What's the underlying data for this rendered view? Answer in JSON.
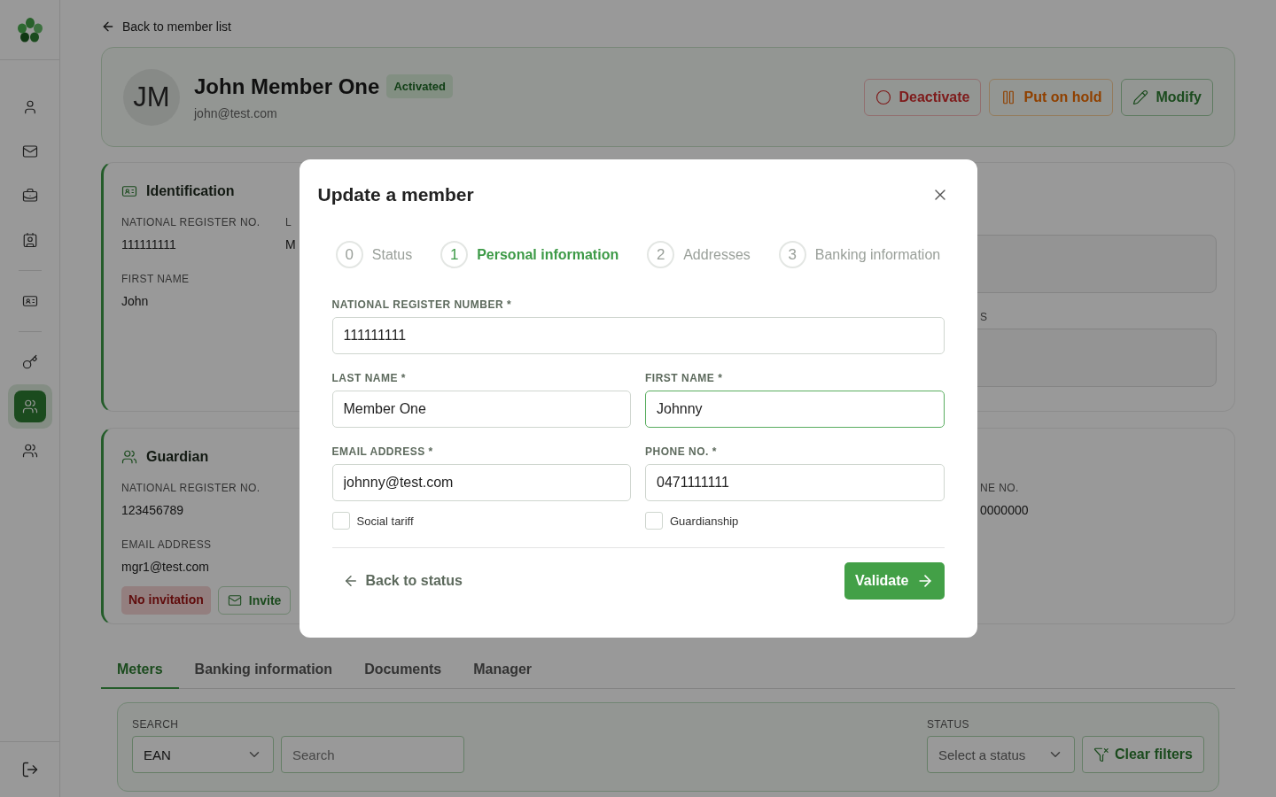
{
  "sidebar": {
    "groups": [
      [
        {
          "selected": false
        },
        {
          "selected": false
        },
        {
          "selected": false
        },
        {
          "selected": false
        }
      ],
      [
        {
          "selected": false
        }
      ],
      [
        {
          "selected": false
        },
        {
          "selected": true
        },
        {
          "selected": false
        }
      ]
    ]
  },
  "back_link": "Back to member list",
  "member": {
    "initials": "JM",
    "name": "John Member One",
    "status": "Activated",
    "email": "john@test.com"
  },
  "actions": [
    {
      "label": "Deactivate",
      "kind": "danger"
    },
    {
      "label": "Put on hold",
      "kind": "warning"
    },
    {
      "label": "Modify",
      "kind": "primary"
    }
  ],
  "identification": {
    "title": "Identification",
    "fields": [
      {
        "label": "NATIONAL REGISTER NO.",
        "value": "111111111"
      },
      {
        "label": "FIRST NAME",
        "value": "John"
      }
    ],
    "column_2": {
      "label": "L",
      "value": "M"
    },
    "column_3": {
      "label": "S"
    }
  },
  "guardian": {
    "title": "Guardian",
    "fields": [
      {
        "label": "NATIONAL REGISTER NO.",
        "value": "123456789"
      },
      {
        "label": "EMAIL ADDRESS",
        "value": "mgr1@test.com"
      }
    ],
    "invitation": "No invitation",
    "invite": "Invite",
    "column_3": {
      "label": "NE NO.",
      "value": "0000000"
    }
  },
  "tabs": [
    {
      "label": "Meters",
      "selected": true
    },
    {
      "label": "Banking information",
      "selected": false
    },
    {
      "label": "Documents",
      "selected": false
    },
    {
      "label": "Manager",
      "selected": false
    }
  ],
  "filters": {
    "search_label": "SEARCH",
    "search_type": "EAN",
    "search_placeholder": "Search",
    "status_label": "STATUS",
    "status_placeholder": "Select a status",
    "clear": "Clear filters"
  },
  "modal": {
    "title": "Update a member",
    "steps": [
      {
        "number": "0",
        "label": "Status",
        "selected": false
      },
      {
        "number": "1",
        "label": "Personal information",
        "selected": true
      },
      {
        "number": "2",
        "label": "Addresses",
        "selected": false
      },
      {
        "number": "3",
        "label": "Banking information",
        "selected": false
      }
    ],
    "rows": [
      [
        {
          "label": "NATIONAL REGISTER NUMBER *",
          "value": "111111111",
          "focused": false
        }
      ],
      [
        {
          "label": "LAST NAME *",
          "value": "Member One",
          "focused": false
        },
        {
          "label": "FIRST NAME *",
          "value": "Johnny",
          "focused": true
        }
      ],
      [
        {
          "label": "EMAIL ADDRESS *",
          "value": "johnny@test.com",
          "focused": false
        },
        {
          "label": "PHONE NO. *",
          "value": "0471111111",
          "focused": false
        }
      ]
    ],
    "checkboxes": [
      {
        "label": "Social tariff",
        "checked": false
      },
      {
        "label": "Guardianship",
        "checked": false
      }
    ],
    "back": "Back to status",
    "submit": "Validate"
  }
}
